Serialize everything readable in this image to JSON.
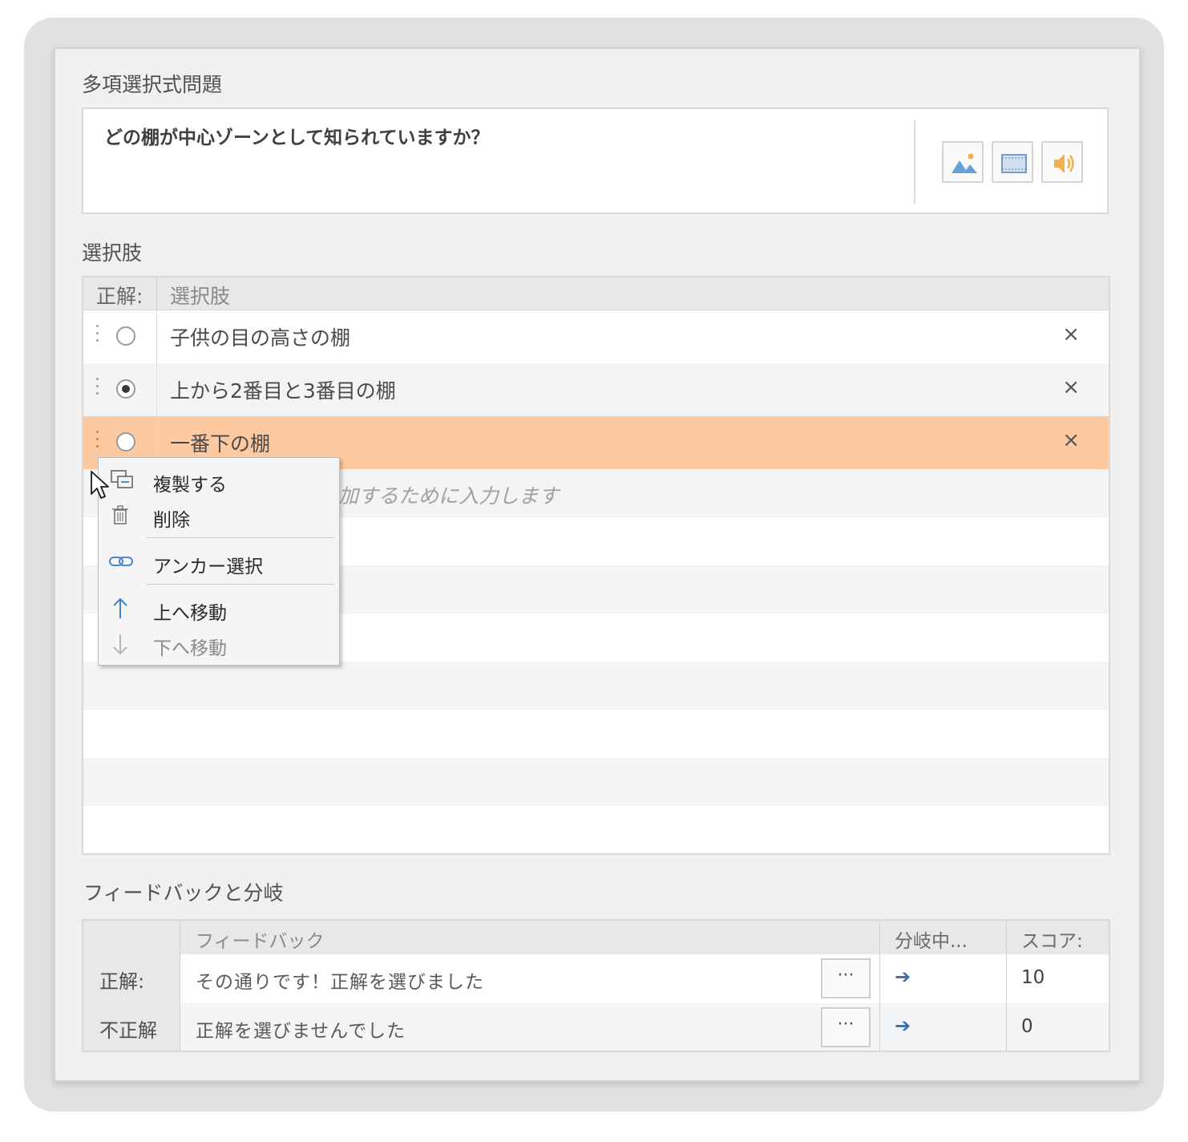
{
  "question_section": {
    "title": "多項選択式問題",
    "question_text": "どの棚が中心ゾーンとして知られていますか？",
    "media_buttons": [
      "image-icon",
      "video-icon",
      "audio-icon"
    ]
  },
  "choices_section": {
    "title": "選択肢",
    "header_correct": "正解:",
    "header_choice": "選択肢",
    "rows": [
      {
        "label": "子供の目の高さの棚",
        "correct": false,
        "selected": false
      },
      {
        "label": "上から2番目と3番目の棚",
        "correct": true,
        "selected": false
      },
      {
        "label": "一番下の棚",
        "correct": false,
        "selected": true
      }
    ],
    "new_choice_placeholder_visible": "加するために入力します",
    "remove_symbol": "×"
  },
  "context_menu": {
    "items": [
      {
        "label": "複製する",
        "icon": "duplicate-icon",
        "disabled": false
      },
      {
        "label": "削除",
        "icon": "trash-icon",
        "disabled": false
      },
      {
        "label": "アンカー選択",
        "icon": "link-icon",
        "disabled": false
      },
      {
        "label": "上へ移動",
        "icon": "arrow-up-icon",
        "disabled": false
      },
      {
        "label": "下へ移動",
        "icon": "arrow-down-icon",
        "disabled": true
      }
    ]
  },
  "feedback_section": {
    "title": "フィードバックと分岐",
    "header_feedback": "フィードバック",
    "header_branch": "分岐中...",
    "header_score": "スコア:",
    "rows": [
      {
        "label": "正解:",
        "feedback": "その通りです！正解を選びました",
        "more": "···",
        "branch_arrow": "➔",
        "score": "10"
      },
      {
        "label": "不正解",
        "feedback": "正解を選びませんでした",
        "more": "···",
        "branch_arrow": "➔",
        "score": "0"
      }
    ]
  },
  "colors": {
    "selected_row": "#fdc9a1",
    "accent_blue": "#3d6ea8",
    "panel_bg": "#f0f0f0"
  }
}
